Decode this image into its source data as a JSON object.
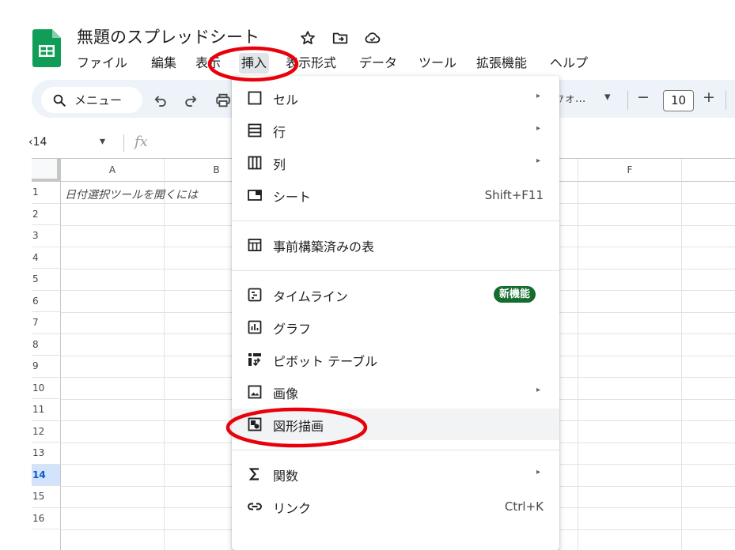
{
  "doc": {
    "title": "無題のスプレッドシート"
  },
  "menubar": {
    "items": [
      "ファイル",
      "編集",
      "表示",
      "挿入",
      "表示形式",
      "データ",
      "ツール",
      "拡張機能",
      "ヘルプ"
    ],
    "active": "挿入"
  },
  "toolbar": {
    "search_label": "メニュー",
    "font_label": "ｧォ...",
    "font_dropdown_glyph": "▾",
    "minus": "−",
    "font_size": "10",
    "plus": "+"
  },
  "formula_bar": {
    "cell_ref": "‹14",
    "dropdown_glyph": "▾",
    "fx": "fx"
  },
  "grid": {
    "columns": [
      "A",
      "B",
      "F"
    ],
    "rows": [
      "1",
      "2",
      "3",
      "4",
      "5",
      "6",
      "7",
      "8",
      "9",
      "10",
      "11",
      "12",
      "13",
      "14",
      "15",
      "16"
    ],
    "selected_row": "14",
    "cell_a1": "日付選択ツールを開くには"
  },
  "insert_menu": {
    "items": [
      {
        "icon": "cell-icon",
        "label": "セル",
        "submenu": true
      },
      {
        "icon": "row-icon",
        "label": "行",
        "submenu": true
      },
      {
        "icon": "column-icon",
        "label": "列",
        "submenu": true
      },
      {
        "icon": "sheet-icon",
        "label": "シート",
        "shortcut": "Shift+F11"
      },
      {
        "icon": "prebuilt-table-icon",
        "label": "事前構築済みの表"
      },
      {
        "icon": "timeline-icon",
        "label": "タイムライン",
        "badge": "新機能"
      },
      {
        "icon": "chart-icon",
        "label": "グラフ"
      },
      {
        "icon": "pivot-table-icon",
        "label": "ピボット テーブル"
      },
      {
        "icon": "image-icon",
        "label": "画像",
        "submenu": true
      },
      {
        "icon": "drawing-icon",
        "label": "図形描画",
        "highlighted": true
      },
      {
        "icon": "sigma-icon",
        "label": "関数",
        "submenu": true
      },
      {
        "icon": "link-icon",
        "label": "リンク",
        "shortcut": "Ctrl+K"
      }
    ],
    "submenu_glyph": "▸"
  },
  "colors": {
    "annotation": "#e8000b",
    "sheets_green": "#0f9d58",
    "badge_green": "#146c2e",
    "selection_blue": "#d3e3fd"
  }
}
